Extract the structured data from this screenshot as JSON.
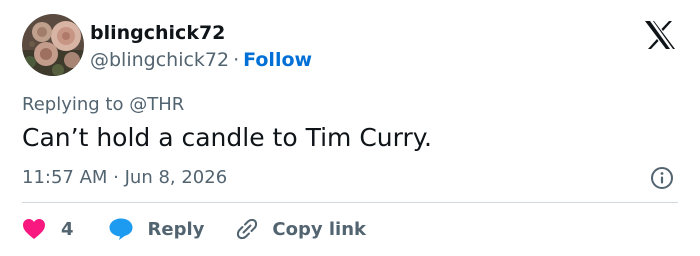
{
  "author": {
    "display_name": "blingchick72",
    "handle": "@blingchick72",
    "separator": "·",
    "follow_label": "Follow"
  },
  "tweet": {
    "replying_to": "Replying to @THR",
    "text": "Can’t hold a candle to Tim Curry.",
    "timestamp": "11:57 AM · Jun 8, 2026"
  },
  "actions": {
    "like_count": "4",
    "reply_label": "Reply",
    "copy_link_label": "Copy link"
  },
  "icons": {
    "logo": "x-logo-icon",
    "info": "info-icon",
    "like": "heart-icon",
    "reply": "speech-bubble-icon",
    "copy": "link-icon"
  },
  "colors": {
    "text": "#0f1419",
    "secondary": "#536471",
    "link": "#006fd6",
    "heart": "#f91880",
    "reply_bubble": "#1d9bf0",
    "divider": "#cfd9de"
  }
}
